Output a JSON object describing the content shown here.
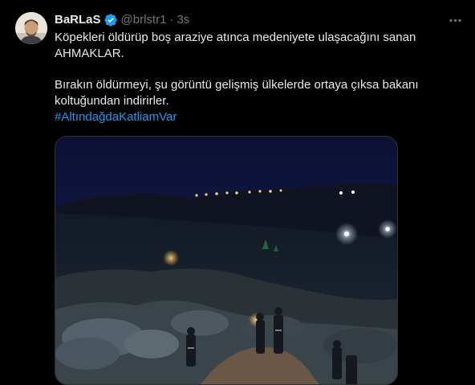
{
  "author": {
    "display_name": "BaRLaS",
    "handle": "@brlstr1",
    "separator": "·",
    "time": "3s",
    "verified": true,
    "verified_color": "#1d9bf0"
  },
  "tweet": {
    "line1": "Köpekleri öldürüp boş araziye atınca medeniyete ulaşacağını sanan",
    "line2": "AHMAKLAR.",
    "line3": "Bırakın öldürmeyi, şu görüntü gelişmiş ülkelerde ortaya çıksa bakanı",
    "line4": "koltuğundan indirirler.",
    "hashtag": "#AltındağdaKatliamVar"
  },
  "icons": {
    "more": "more-horizontal-icon",
    "verified": "verified-badge-icon"
  },
  "colors": {
    "background": "#000000",
    "text": "#e7e9ea",
    "muted": "#71767b",
    "link": "#1d9bf0",
    "border": "#2f3336"
  }
}
